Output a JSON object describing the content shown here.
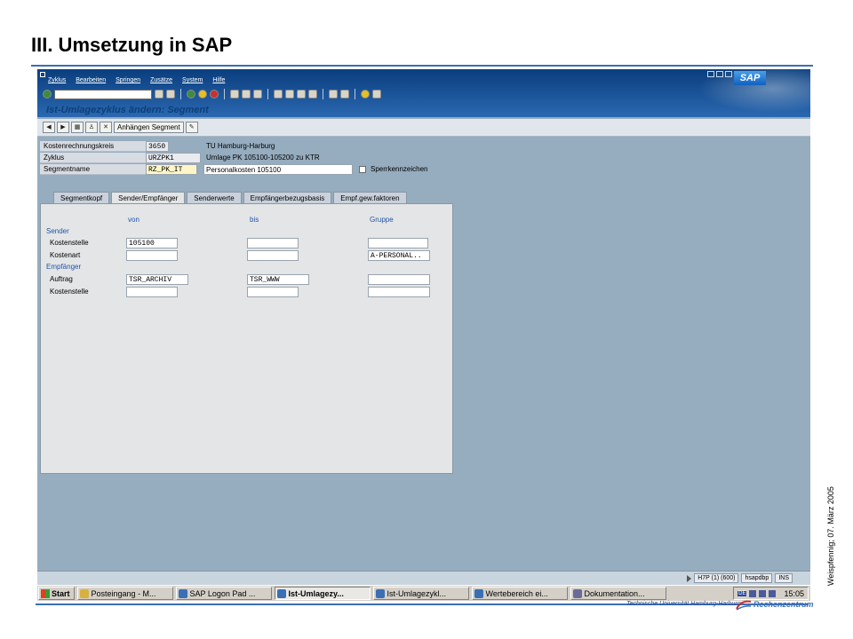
{
  "slide": {
    "title": "III. Umsetzung in SAP",
    "date_text": "Weispfennig; 07. März 2005",
    "footer_university": "Technische Universität Hamburg-Harburg",
    "footer_rz": "Rechenzentrum"
  },
  "sap": {
    "logo": "SAP",
    "menu": [
      "Zyklus",
      "Bearbeiten",
      "Springen",
      "Zusätze",
      "System",
      "Hilfe"
    ],
    "command_field": "",
    "screen_title": "Ist-Umlagezyklus ändern: Segment",
    "appbar": {
      "attach_segment": "Anhängen Segment"
    },
    "header_fields": {
      "kostenrechnungskreis_label": "Kostenrechnungskreis",
      "kostenrechnungskreis_value": "3650",
      "kostenrechnungskreis_text": "TU Hamburg-Harburg",
      "zyklus_label": "Zyklus",
      "zyklus_value": "URZPK1",
      "zyklus_text": "Umlage PK 105100-105200 zu KTR",
      "segmentname_label": "Segmentname",
      "segmentname_value": "RZ_PK_IT",
      "segmentname_text": "Personalkosten 105100",
      "sperrkennzeichen_label": "Sperrkennzeichen",
      "sperrkennzeichen_checked": false
    },
    "tabs": [
      {
        "label": "Segmentkopf",
        "active": false
      },
      {
        "label": "Sender/Empfänger",
        "active": true
      },
      {
        "label": "Senderwerte",
        "active": false
      },
      {
        "label": "Empfängerbezugsbasis",
        "active": false
      },
      {
        "label": "Empf.gew.faktoren",
        "active": false
      }
    ],
    "columns": {
      "von": "von",
      "bis": "bis",
      "gruppe": "Gruppe"
    },
    "sender": {
      "section": "Sender",
      "rows": [
        {
          "label": "Kostenstelle",
          "von": "105100",
          "bis": "",
          "gruppe": ""
        },
        {
          "label": "Kostenart",
          "von": "",
          "bis": "",
          "gruppe": "A-PERSONAL.."
        }
      ]
    },
    "empfaenger": {
      "section": "Empfänger",
      "rows": [
        {
          "label": "Auftrag",
          "von": "TSR_ARCHIV",
          "bis": "TSR_WWW",
          "gruppe": ""
        },
        {
          "label": "Kostenstelle",
          "von": "",
          "bis": "",
          "gruppe": ""
        }
      ]
    },
    "status": {
      "system": "H7P (1) (600)",
      "server": "hsapdbp",
      "mode": "INS"
    }
  },
  "taskbar": {
    "start": "Start",
    "tasks": [
      {
        "label": "Posteingang - M...",
        "active": false,
        "icon": "mail-icon"
      },
      {
        "label": "SAP Logon Pad ...",
        "active": false,
        "icon": "sap-icon"
      },
      {
        "label": "Ist-Umlagezy...",
        "active": true,
        "icon": "sap-icon"
      },
      {
        "label": "Ist-Umlagezykl...",
        "active": false,
        "icon": "sap-icon"
      },
      {
        "label": "Wertebereich ei...",
        "active": false,
        "icon": "sap-icon"
      },
      {
        "label": "Dokumentation...",
        "active": false,
        "icon": "doc-icon"
      }
    ],
    "lang": "DE",
    "clock": "15:05"
  }
}
